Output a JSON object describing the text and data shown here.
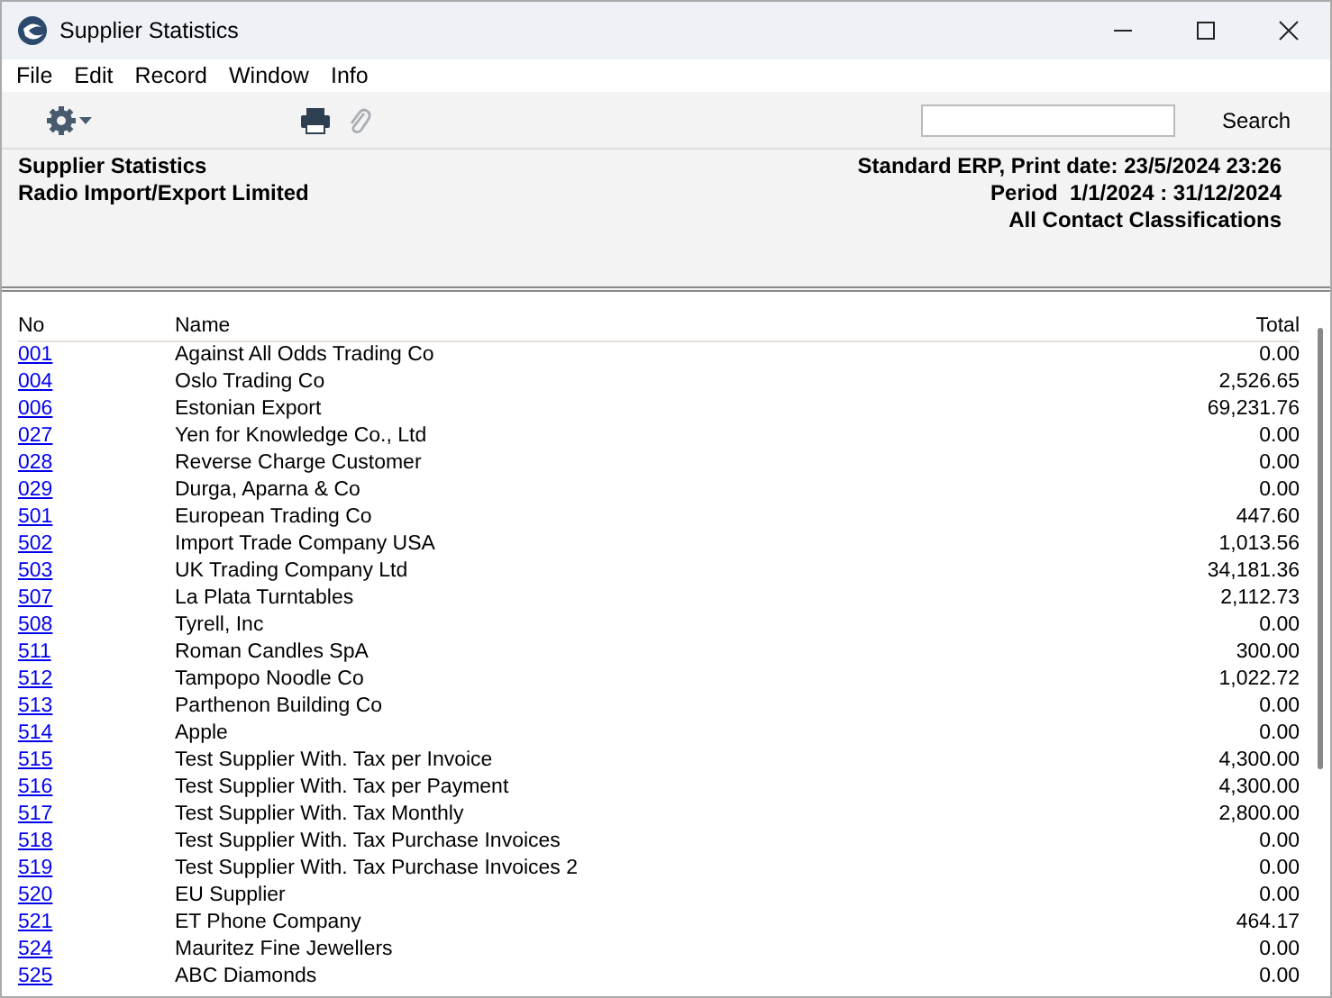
{
  "window": {
    "title": "Supplier Statistics"
  },
  "menu": [
    "File",
    "Edit",
    "Record",
    "Window",
    "Info"
  ],
  "toolbar": {
    "search_button": "Search"
  },
  "header": {
    "left": [
      "Supplier Statistics",
      "Radio Import/Export Limited"
    ],
    "right": [
      "Standard ERP, Print date: 23/5/2024 23:26",
      "Period  1/1/2024 : 31/12/2024",
      "All Contact Classifications"
    ]
  },
  "table": {
    "columns": [
      "No",
      "Name",
      "Total"
    ],
    "rows": [
      {
        "no": "001",
        "name": "Against All Odds Trading Co",
        "total": "0.00"
      },
      {
        "no": "004",
        "name": "Oslo Trading Co",
        "total": "2,526.65"
      },
      {
        "no": "006",
        "name": "Estonian Export",
        "total": "69,231.76"
      },
      {
        "no": "027",
        "name": "Yen for Knowledge Co., Ltd",
        "total": "0.00"
      },
      {
        "no": "028",
        "name": "Reverse Charge Customer",
        "total": "0.00"
      },
      {
        "no": "029",
        "name": "Durga, Aparna & Co",
        "total": "0.00"
      },
      {
        "no": "501",
        "name": "European Trading Co",
        "total": "447.60"
      },
      {
        "no": "502",
        "name": "Import Trade Company USA",
        "total": "1,013.56"
      },
      {
        "no": "503",
        "name": "UK Trading Company Ltd",
        "total": "34,181.36"
      },
      {
        "no": "507",
        "name": "La Plata Turntables",
        "total": "2,112.73"
      },
      {
        "no": "508",
        "name": "Tyrell, Inc",
        "total": "0.00"
      },
      {
        "no": "511",
        "name": "Roman Candles SpA",
        "total": "300.00"
      },
      {
        "no": "512",
        "name": "Tampopo Noodle Co",
        "total": "1,022.72"
      },
      {
        "no": "513",
        "name": "Parthenon Building Co",
        "total": "0.00"
      },
      {
        "no": "514",
        "name": "Apple",
        "total": "0.00"
      },
      {
        "no": "515",
        "name": "Test Supplier With. Tax per Invoice",
        "total": "4,300.00"
      },
      {
        "no": "516",
        "name": "Test Supplier With. Tax per Payment",
        "total": "4,300.00"
      },
      {
        "no": "517",
        "name": "Test Supplier With. Tax Monthly",
        "total": "2,800.00"
      },
      {
        "no": "518",
        "name": "Test Supplier With. Tax Purchase Invoices",
        "total": "0.00"
      },
      {
        "no": "519",
        "name": "Test Supplier With. Tax Purchase Invoices 2",
        "total": "0.00"
      },
      {
        "no": "520",
        "name": "EU Supplier",
        "total": "0.00"
      },
      {
        "no": "521",
        "name": "ET Phone Company",
        "total": "464.17"
      },
      {
        "no": "524",
        "name": "Mauritez Fine Jewellers",
        "total": "0.00"
      },
      {
        "no": "525",
        "name": "ABC Diamonds",
        "total": "0.00"
      }
    ]
  }
}
